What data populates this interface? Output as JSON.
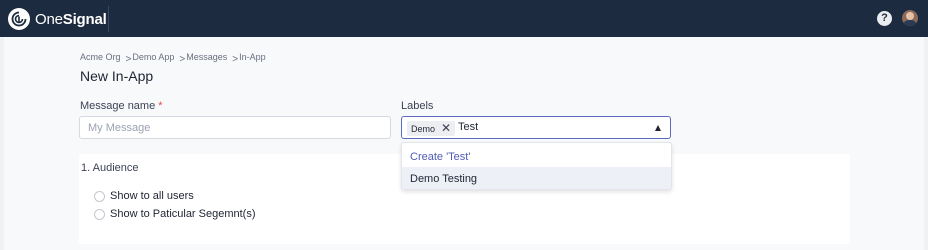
{
  "brand": {
    "name_light": "One",
    "name_bold": "Signal"
  },
  "header": {
    "help_label": "?",
    "colors": {
      "bar": "#1c2b3f",
      "accent": "#5b69c3"
    }
  },
  "breadcrumb": [
    "Acme Org",
    "Demo App",
    "Messages",
    "In-App"
  ],
  "page_title": "New In-App",
  "form": {
    "message_name_label": "Message name",
    "required_mark": "*",
    "message_name_placeholder": "My Message",
    "labels_label": "Labels",
    "labels_chips": [
      "Demo"
    ],
    "labels_input_value": "Test"
  },
  "dropdown": {
    "create_option": "Create 'Test'",
    "options": [
      "Demo Testing"
    ]
  },
  "audience": {
    "title": "1. Audience",
    "options": [
      "Show to all users",
      "Show to Paticular Segemnt(s)"
    ]
  }
}
